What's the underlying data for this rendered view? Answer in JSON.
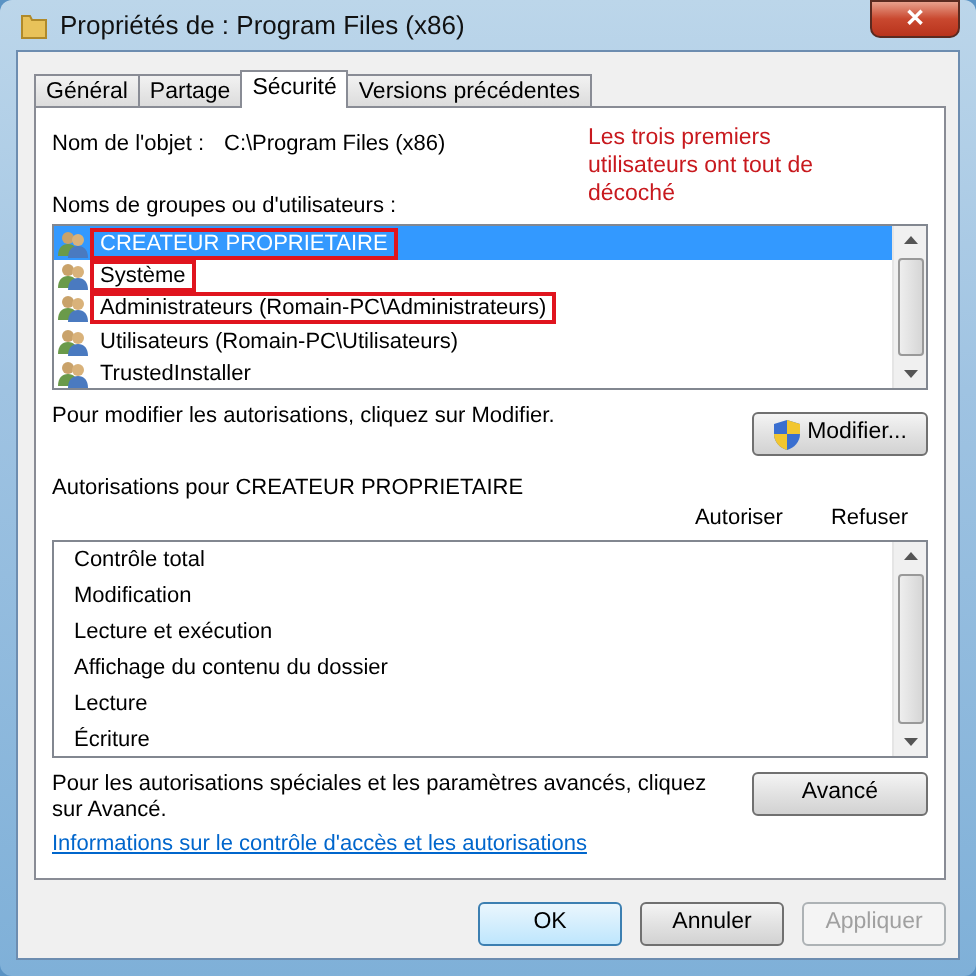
{
  "window": {
    "title": "Propriétés de : Program Files (x86)",
    "close": "✕"
  },
  "tabs": [
    {
      "label": "Général",
      "selected": false
    },
    {
      "label": "Partage",
      "selected": false
    },
    {
      "label": "Sécurité",
      "selected": true
    },
    {
      "label": "Versions précédentes",
      "selected": false
    }
  ],
  "object_name": {
    "label": "Nom de l'objet :",
    "value": "C:\\Program Files (x86)"
  },
  "note": "Les trois premiers utilisateurs ont tout de décoché",
  "users_label": "Noms de groupes ou d'utilisateurs :",
  "users": [
    {
      "name": "CREATEUR PROPRIETAIRE",
      "selected": true,
      "highlighted": true
    },
    {
      "name": "Système",
      "selected": false,
      "highlighted": true
    },
    {
      "name": "Administrateurs (Romain-PC\\Administrateurs)",
      "selected": false,
      "highlighted": true
    },
    {
      "name": "Utilisateurs (Romain-PC\\Utilisateurs)",
      "selected": false,
      "highlighted": false
    },
    {
      "name": "TrustedInstaller",
      "selected": false,
      "highlighted": false
    }
  ],
  "modify_hint": "Pour modifier les autorisations, cliquez sur Modifier.",
  "modify_button": "Modifier...",
  "permissions_label": "Autorisations pour CREATEUR PROPRIETAIRE",
  "permission_columns": [
    "Autoriser",
    "Refuser"
  ],
  "permissions": [
    "Contrôle total",
    "Modification",
    "Lecture et exécution",
    "Affichage du contenu du dossier",
    "Lecture",
    "Écriture"
  ],
  "advanced_hint": "Pour les autorisations spéciales et les paramètres avancés, cliquez sur Avancé.",
  "advanced_button": "Avancé",
  "help_link": "Informations sur le contrôle d'accès et les autorisations",
  "buttons": [
    {
      "label": "OK",
      "disabled": false,
      "default": true
    },
    {
      "label": "Annuler",
      "disabled": false,
      "default": false
    },
    {
      "label": "Appliquer",
      "disabled": true,
      "default": false
    }
  ]
}
